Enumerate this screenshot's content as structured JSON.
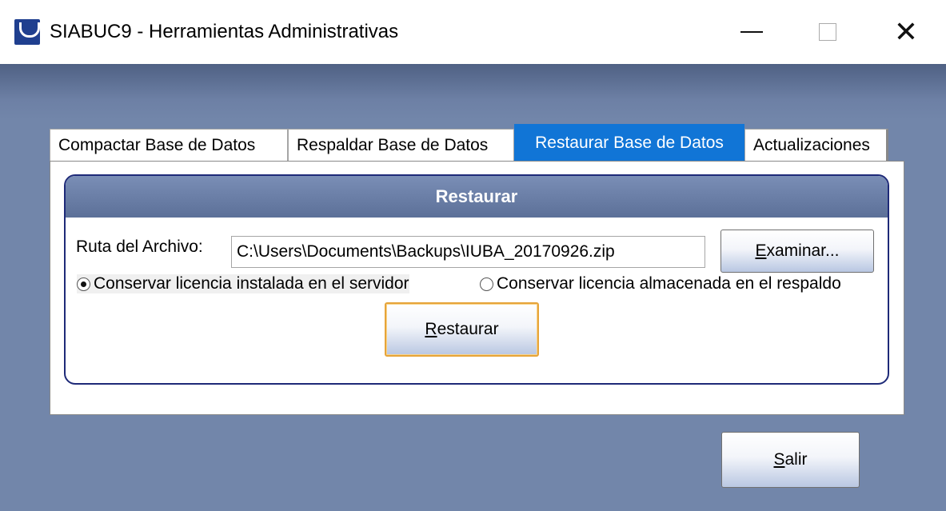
{
  "window": {
    "title": "SIABUC9 - Herramientas Administrativas",
    "icon": "siabuc-app-icon",
    "controls": [
      "minimize-icon",
      "maximize-icon",
      "close-icon"
    ],
    "close_glyph": "✕"
  },
  "tabs": [
    {
      "label": "Compactar Base de Datos",
      "active": false
    },
    {
      "label": "Respaldar Base de Datos",
      "active": false
    },
    {
      "label": "Restaurar Base de Datos",
      "active": true
    },
    {
      "label": "Actualizaciones",
      "active": false
    }
  ],
  "restore_panel": {
    "header": "Restaurar",
    "path_label": "Ruta del Archivo:",
    "path_value": "C:\\Users\\Documents\\Backups\\IUBA_20170926.zip",
    "browse_button": {
      "mnemonic": "E",
      "rest": "xaminar..."
    },
    "radio_options": [
      {
        "label": "Conservar licencia instalada en el servidor",
        "checked": true
      },
      {
        "label": "Conservar licencia almacenada en el respaldo",
        "checked": false
      }
    ],
    "restore_button": {
      "mnemonic": "R",
      "rest": "estaurar"
    }
  },
  "exit_button": {
    "mnemonic": "S",
    "rest": "alir"
  },
  "colors": {
    "active_tab": "#1175d6",
    "background": "#7286aa",
    "panel_border": "#1e2a78",
    "focus_border": "#e6a43a"
  }
}
